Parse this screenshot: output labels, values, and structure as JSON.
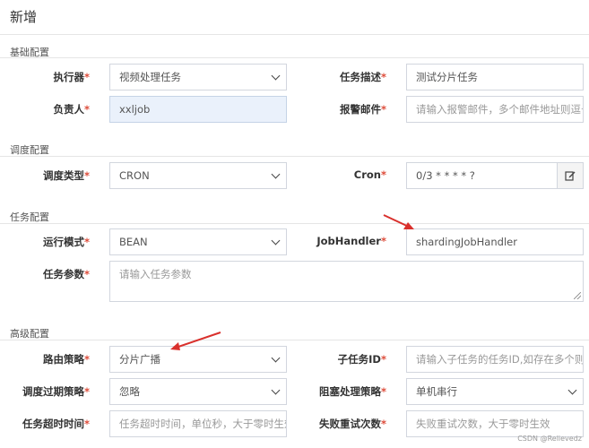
{
  "page": {
    "title": "新增"
  },
  "sections": {
    "basic": "基础配置",
    "schedule": "调度配置",
    "task": "任务配置",
    "advanced": "高级配置"
  },
  "required_mark": "*",
  "basic": {
    "executor": {
      "label": "执行器",
      "value": "视频处理任务"
    },
    "desc": {
      "label": "任务描述",
      "value": "测试分片任务"
    },
    "owner": {
      "label": "负责人",
      "value": "xxljob"
    },
    "alarm": {
      "label": "报警邮件",
      "placeholder": "请输入报警邮件，多个邮件地址则逗号分隔"
    }
  },
  "schedule": {
    "type": {
      "label": "调度类型",
      "value": "CRON"
    },
    "cron": {
      "label": "Cron",
      "value": "0/3 * * * * ?"
    }
  },
  "task": {
    "mode": {
      "label": "运行模式",
      "value": "BEAN"
    },
    "handler": {
      "label": "JobHandler",
      "value": "shardingJobHandler"
    },
    "param": {
      "label": "任务参数",
      "placeholder": "请输入任务参数"
    }
  },
  "advanced": {
    "route": {
      "label": "路由策略",
      "value": "分片广播"
    },
    "child": {
      "label": "子任务ID",
      "placeholder": "请输入子任务的任务ID,如存在多个则逗号分隔"
    },
    "expire": {
      "label": "调度过期策略",
      "value": "忽略"
    },
    "block": {
      "label": "阻塞处理策略",
      "value": "单机串行"
    },
    "timeout": {
      "label": "任务超时时间",
      "placeholder": "任务超时时间，单位秒，大于零时生效"
    },
    "retry": {
      "label": "失败重试次数",
      "placeholder": "失败重试次数，大于零时生效"
    }
  },
  "icons": {
    "cron_edit": "edit-icon"
  },
  "watermark": "CSDN @Relievedz",
  "colors": {
    "required": "#dd4b39",
    "annotation_arrow": "#d9302c"
  }
}
